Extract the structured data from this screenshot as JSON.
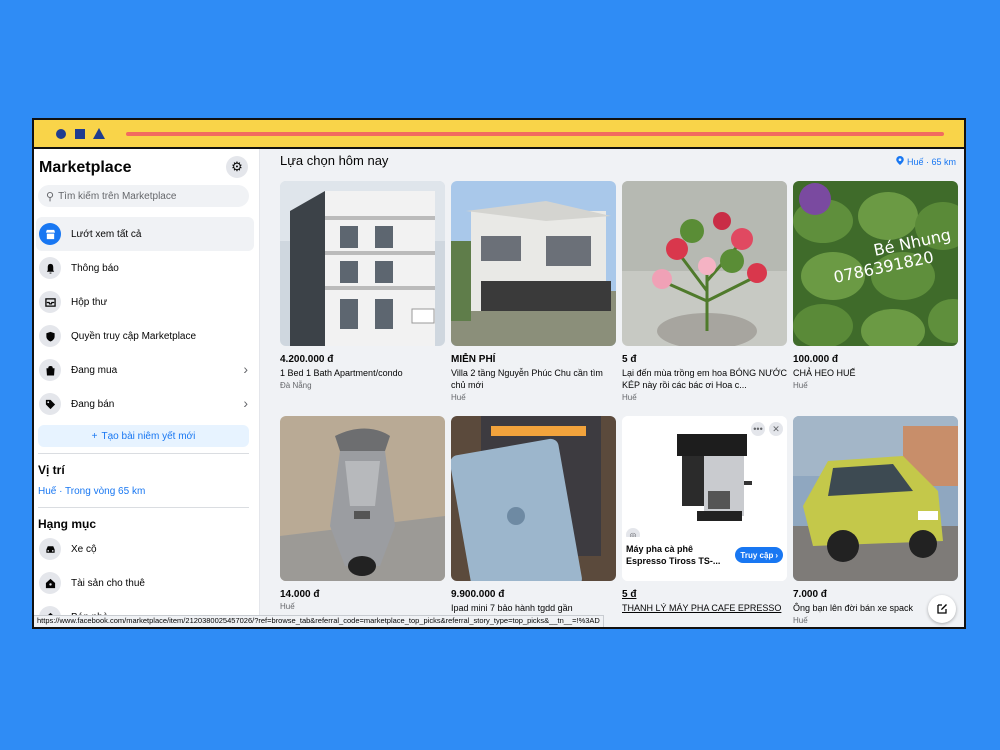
{
  "sidebar": {
    "title": "Marketplace",
    "search_placeholder": "Tìm kiếm trên Marketplace",
    "nav": [
      {
        "label": "Lướt xem tất cả",
        "icon": "storefront-icon"
      },
      {
        "label": "Thông báo",
        "icon": "bell-icon"
      },
      {
        "label": "Hộp thư",
        "icon": "inbox-icon"
      },
      {
        "label": "Quyền truy cập Marketplace",
        "icon": "shield-icon"
      },
      {
        "label": "Đang mua",
        "icon": "shopping-bag-icon"
      },
      {
        "label": "Đang bán",
        "icon": "tag-icon"
      }
    ],
    "create_listing": "Tạo bài niêm yết mới",
    "location_title": "Vị trí",
    "location_value": "Huế · Trong vòng 65 km",
    "categories_title": "Hạng mục",
    "categories": [
      {
        "label": "Xe cộ",
        "icon": "car-icon"
      },
      {
        "label": "Tài sản cho thuê",
        "icon": "house-key-icon"
      },
      {
        "label": "Bán nhà",
        "icon": "house-icon"
      }
    ]
  },
  "main": {
    "title": "Lựa chọn hôm nay",
    "location": "Huế · 65 km",
    "listings": [
      {
        "price": "4.200.000 đ",
        "title": "1 Bed 1 Bath Apartment/condo",
        "location": "Đà Nẵng"
      },
      {
        "price": "MIỄN PHÍ",
        "title": "Villa 2 tầng Nguyễn Phúc Chu cần tìm chủ mới",
        "location": "Huế"
      },
      {
        "price": "5 đ",
        "title": "Lại đến mùa trồng em hoa BÓNG NƯỚC KÉP này rồi các bác ơi Hoa c...",
        "location": "Huế"
      },
      {
        "price": "100.000 đ",
        "title": "CHẢ HEO HUẾ",
        "location": "Huế",
        "overlay": "Bé Nhung 0786391820"
      },
      {
        "price": "14.000 đ",
        "title": "",
        "location": "Huế"
      },
      {
        "price": "9.900.000 đ",
        "title": "Ipad mini 7 bảo hành tgdd gần",
        "location": ""
      },
      {
        "price": "5 đ",
        "title": "THANH LÝ MÁY PHA CAFE EPRESSO",
        "location": "",
        "ad_title": "Máy pha cà phê Espresso Tiross TS-...",
        "ad_button": "Truy cập"
      },
      {
        "price": "7.000 đ",
        "title": "Ông bạn lên đời bán xe spack",
        "location": "Huế"
      }
    ]
  },
  "status_url": "https://www.facebook.com/marketplace/item/2120380025457026/?ref=browse_tab&referral_code=marketplace_top_picks&referral_story_type=top_picks&__tn__=!%3AD",
  "colors": {
    "accent": "#1877f2",
    "titlebar": "#f9d449",
    "background": "#2f8cf5"
  }
}
